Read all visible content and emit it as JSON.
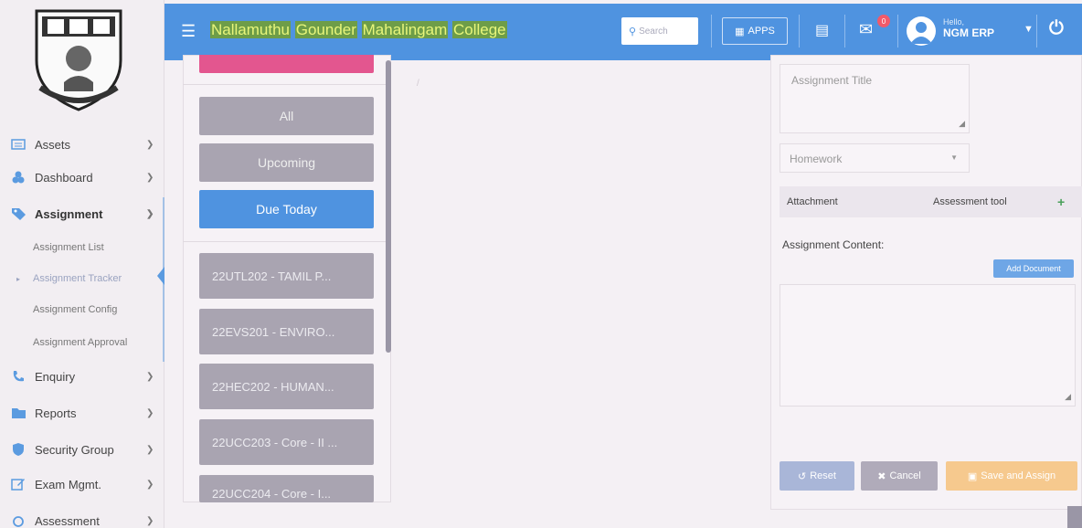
{
  "header": {
    "title_words": [
      "Nallamuthu",
      "Gounder",
      "Mahalingam",
      "College"
    ],
    "search_placeholder": "Search",
    "apps_label": "APPS",
    "notification_count": "0",
    "hello": "Hello,",
    "user_name": "NGM ERP"
  },
  "sidebar": {
    "items": [
      {
        "label": "Assets",
        "icon": "assets-icon"
      },
      {
        "label": "Dashboard",
        "icon": "dashboard-icon"
      },
      {
        "label": "Assignment",
        "icon": "tags-icon"
      },
      {
        "label": "Enquiry",
        "icon": "phone-icon"
      },
      {
        "label": "Reports",
        "icon": "folder-icon"
      },
      {
        "label": "Security Group",
        "icon": "shield-icon"
      },
      {
        "label": "Exam Mgmt.",
        "icon": "edit-icon"
      },
      {
        "label": "Assessment",
        "icon": "circle-icon"
      }
    ],
    "sub_items": [
      {
        "label": "Assignment List"
      },
      {
        "label": "Assignment Tracker"
      },
      {
        "label": "Assignment Config"
      },
      {
        "label": "Assignment Approval"
      }
    ]
  },
  "filters": {
    "all": "All",
    "upcoming": "Upcoming",
    "due_today": "Due Today"
  },
  "subjects": [
    "22UTL202 - TAMIL P...",
    "22EVS201 - ENVIRO...",
    "22HEC202 - HUMAN...",
    "22UCC203 - Core - II ...",
    "22UCC204 - Core - I..."
  ],
  "form": {
    "title_placeholder": "Assignment Title",
    "type_value": "Homework",
    "attachment_label": "Attachment",
    "assessment_tool_label": "Assessment tool",
    "content_label": "Assignment Content:",
    "add_document_label": "Add Document",
    "reset_label": "Reset",
    "cancel_label": "Cancel",
    "save_label": "Save and Assign"
  },
  "colors": {
    "header": "#4f93e0",
    "active_filter": "#4f93e0",
    "filter": "#a9a4b1",
    "new_button": "#e3568f",
    "save": "#f6c98e"
  }
}
